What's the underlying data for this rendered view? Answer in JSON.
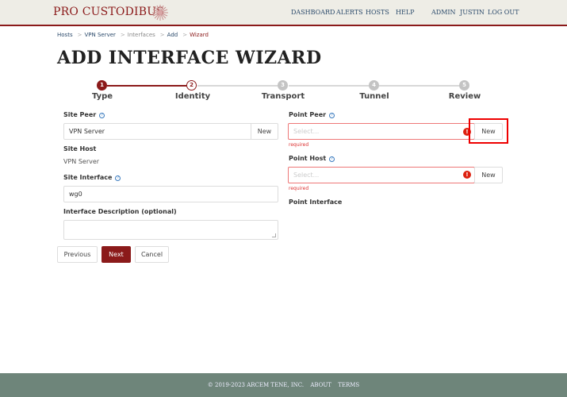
{
  "header": {
    "brand": "PRO CUSTODIBUS",
    "logo_icon": "brand-emblem-icon",
    "nav": [
      "DASHBOARD",
      "ALERTS",
      "HOSTS",
      "HELP"
    ],
    "user_nav": [
      "ADMIN",
      "JUSTIN",
      "LOG OUT"
    ]
  },
  "breadcrumb": {
    "items": [
      "Hosts",
      "VPN Server",
      "Interfaces",
      "Add",
      "Wizard"
    ],
    "separator": ">"
  },
  "page_title": "ADD INTERFACE WIZARD",
  "wizard": {
    "current_step": 2,
    "steps": [
      {
        "number": "1",
        "label": "Type",
        "state": "done"
      },
      {
        "number": "2",
        "label": "Identity",
        "state": "current"
      },
      {
        "number": "3",
        "label": "Transport",
        "state": "todo"
      },
      {
        "number": "4",
        "label": "Tunnel",
        "state": "todo"
      },
      {
        "number": "5",
        "label": "Review",
        "state": "todo"
      }
    ]
  },
  "form": {
    "site_peer": {
      "label": "Site Peer",
      "value": "VPN Server",
      "new_label": "New",
      "help_icon": "question-circle-icon"
    },
    "site_host": {
      "label": "Site Host",
      "value": "VPN Server"
    },
    "site_interface": {
      "label": "Site Interface",
      "value": "wg0",
      "help_icon": "question-circle-icon"
    },
    "interface_description": {
      "label": "Interface Description (optional)",
      "value": ""
    },
    "point_peer": {
      "label": "Point Peer",
      "placeholder": "Select...",
      "new_label": "New",
      "error": "required",
      "help_icon": "question-circle-icon",
      "error_icon": "exclamation-circle-icon"
    },
    "point_host": {
      "label": "Point Host",
      "placeholder": "Select...",
      "new_label": "New",
      "error": "required",
      "help_icon": "question-circle-icon",
      "error_icon": "exclamation-circle-icon"
    },
    "point_interface": {
      "label": "Point Interface"
    }
  },
  "actions": {
    "previous": "Previous",
    "next": "Next",
    "cancel": "Cancel"
  },
  "footer": {
    "copyright": "© 2019-2023 ARCEM TENE, INC.",
    "links": [
      "ABOUT",
      "TERMS"
    ]
  },
  "colors": {
    "brand": "#8b1a1a",
    "header_bg": "#eeede6",
    "footer_bg": "#6e857a",
    "link": "#2b4a6b",
    "error": "#dd2211",
    "highlight": "#ee0000"
  }
}
